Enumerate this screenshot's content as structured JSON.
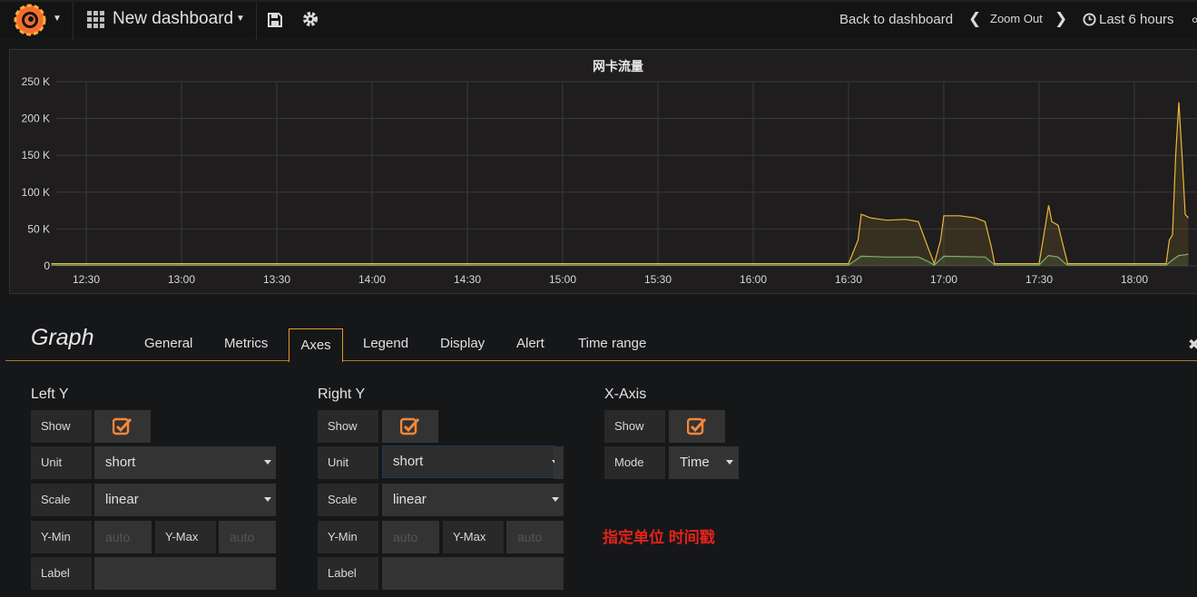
{
  "navbar": {
    "dashboard_title": "New dashboard",
    "back_to_dashboard": "Back to dashboard",
    "zoom_out": "Zoom Out",
    "time_range": "Last 6 hours"
  },
  "panel": {
    "title": "网卡流量"
  },
  "chart_data": {
    "type": "area",
    "title": "网卡流量",
    "xlabel": "",
    "ylabel": "",
    "y_ticks": [
      "0",
      "50 K",
      "100 K",
      "150 K",
      "200 K",
      "250 K"
    ],
    "x_ticks": [
      "12:30",
      "13:00",
      "13:30",
      "14:00",
      "14:30",
      "15:00",
      "15:30",
      "16:00",
      "16:30",
      "17:00",
      "17:30",
      "18:00"
    ],
    "ylim": [
      0,
      250000
    ],
    "grid": true,
    "legend": "none",
    "series": [
      {
        "color": "#eab839",
        "points": [
          [
            "12:19",
            3000
          ],
          [
            "16:30",
            3000
          ],
          [
            "16:33",
            35000
          ],
          [
            "16:34",
            70000
          ],
          [
            "16:37",
            65000
          ],
          [
            "16:42",
            62000
          ],
          [
            "16:48",
            63000
          ],
          [
            "16:52",
            60000
          ],
          [
            "16:55",
            25000
          ],
          [
            "16:57",
            3000
          ],
          [
            "16:59",
            35000
          ],
          [
            "17:00",
            68000
          ],
          [
            "17:05",
            68000
          ],
          [
            "17:10",
            65000
          ],
          [
            "17:13",
            60000
          ],
          [
            "17:15",
            25000
          ],
          [
            "17:16",
            3000
          ],
          [
            "17:30",
            3000
          ],
          [
            "17:32",
            55000
          ],
          [
            "17:33",
            82000
          ],
          [
            "17:34",
            60000
          ],
          [
            "17:36",
            55000
          ],
          [
            "17:38",
            20000
          ],
          [
            "17:39",
            3000
          ],
          [
            "18:10",
            3000
          ],
          [
            "18:11",
            35000
          ],
          [
            "18:12",
            42000
          ],
          [
            "18:13",
            150000
          ],
          [
            "18:14",
            222000
          ],
          [
            "18:15",
            150000
          ],
          [
            "18:16",
            70000
          ],
          [
            "18:17",
            65000
          ]
        ]
      },
      {
        "color": "#7eb26d",
        "points": [
          [
            "12:19",
            1000
          ],
          [
            "16:30",
            1000
          ],
          [
            "16:33",
            10000
          ],
          [
            "16:34",
            13000
          ],
          [
            "16:42",
            12000
          ],
          [
            "16:52",
            12000
          ],
          [
            "16:55",
            6000
          ],
          [
            "16:57",
            1000
          ],
          [
            "16:59",
            9000
          ],
          [
            "17:00",
            13000
          ],
          [
            "17:13",
            12000
          ],
          [
            "17:15",
            5000
          ],
          [
            "17:16",
            1000
          ],
          [
            "17:30",
            1000
          ],
          [
            "17:32",
            10000
          ],
          [
            "17:33",
            14000
          ],
          [
            "17:36",
            12000
          ],
          [
            "17:38",
            4000
          ],
          [
            "17:39",
            1000
          ],
          [
            "18:10",
            1000
          ],
          [
            "18:12",
            8000
          ],
          [
            "18:14",
            14000
          ],
          [
            "18:16",
            15000
          ],
          [
            "18:17",
            16000
          ]
        ]
      }
    ]
  },
  "editor": {
    "title": "Graph",
    "tabs": [
      "General",
      "Metrics",
      "Axes",
      "Legend",
      "Display",
      "Alert",
      "Time range"
    ],
    "active_tab": "Axes",
    "left_y": {
      "heading": "Left Y",
      "show_label": "Show",
      "show_checked": true,
      "unit_label": "Unit",
      "unit_value": "short",
      "scale_label": "Scale",
      "scale_value": "linear",
      "ymin_label": "Y-Min",
      "ymin_placeholder": "auto",
      "ymax_label": "Y-Max",
      "ymax_placeholder": "auto",
      "label_label": "Label",
      "label_value": ""
    },
    "right_y": {
      "heading": "Right Y",
      "show_label": "Show",
      "show_checked": true,
      "unit_label": "Unit",
      "unit_value": "short",
      "scale_label": "Scale",
      "scale_value": "linear",
      "ymin_label": "Y-Min",
      "ymin_placeholder": "auto",
      "ymax_label": "Y-Max",
      "ymax_placeholder": "auto",
      "label_label": "Label",
      "label_value": ""
    },
    "x_axis": {
      "heading": "X-Axis",
      "show_label": "Show",
      "show_checked": true,
      "mode_label": "Mode",
      "mode_value": "Time"
    },
    "annotation": "指定单位  时间戳"
  },
  "colors": {
    "accent": "#e39a2d",
    "checkbox": "#f5873a",
    "annotation": "#e3231b",
    "series_yellow": "#eab839",
    "series_green": "#7eb26d"
  },
  "icons": [
    "grafana-logo-icon",
    "dashboard-grid-icon",
    "save-icon",
    "cog-icon",
    "chevron-left-icon",
    "chevron-right-icon",
    "clock-icon",
    "share-icon",
    "close-icon",
    "checkbox-checked-icon",
    "caret-down-icon"
  ]
}
